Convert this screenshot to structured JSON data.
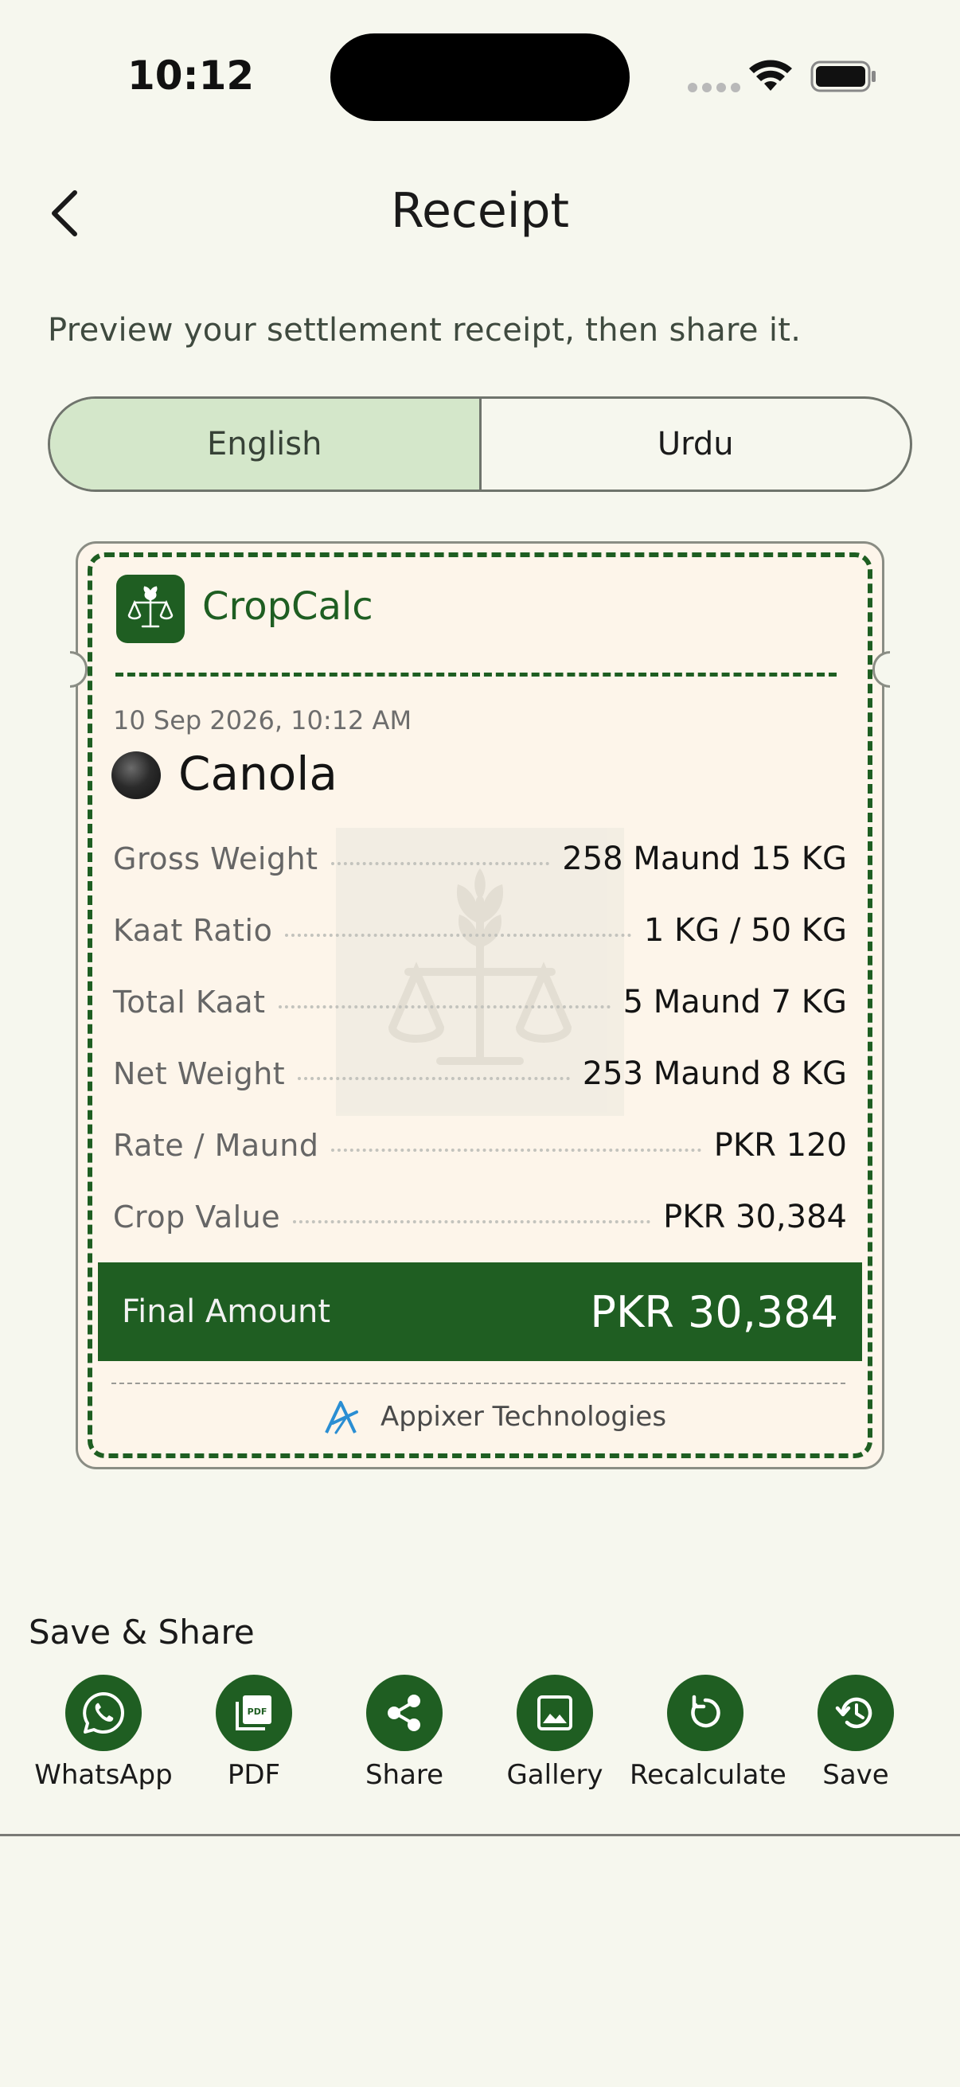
{
  "status_bar": {
    "time": "10:12"
  },
  "header": {
    "title": "Receipt"
  },
  "subtitle": "Preview your settlement receipt, then share it.",
  "language_toggle": {
    "options": [
      "English",
      "Urdu"
    ],
    "selected": "English"
  },
  "receipt": {
    "app_name": "CropCalc",
    "date": "10 Sep 2026, 10:12 AM",
    "crop": "Canola",
    "rows": [
      {
        "label": "Gross Weight",
        "value": "258 Maund 15 KG"
      },
      {
        "label": "Kaat Ratio",
        "value": "1 KG / 50 KG"
      },
      {
        "label": "Total Kaat",
        "value": "5 Maund 7 KG"
      },
      {
        "label": "Net Weight",
        "value": "253 Maund 8 KG"
      },
      {
        "label": "Rate / Maund",
        "value": "PKR 120"
      },
      {
        "label": "Crop Value",
        "value": "PKR 30,384"
      }
    ],
    "final_label": "Final Amount",
    "final_value": "PKR 30,384",
    "company": "Appixer Technologies"
  },
  "share": {
    "title": "Save & Share",
    "actions": [
      {
        "label": "WhatsApp",
        "icon": "whatsapp-icon"
      },
      {
        "label": "PDF",
        "icon": "pdf-icon"
      },
      {
        "label": "Share",
        "icon": "share-icon"
      },
      {
        "label": "Gallery",
        "icon": "gallery-icon"
      },
      {
        "label": "Recalculate",
        "icon": "refresh-icon"
      },
      {
        "label": "Save",
        "icon": "history-icon"
      }
    ]
  },
  "colors": {
    "brand_green": "#1f5e22",
    "background": "#f6f7ee",
    "receipt_paper": "#fdf5ea",
    "toggle_active": "#d4e7ca"
  }
}
